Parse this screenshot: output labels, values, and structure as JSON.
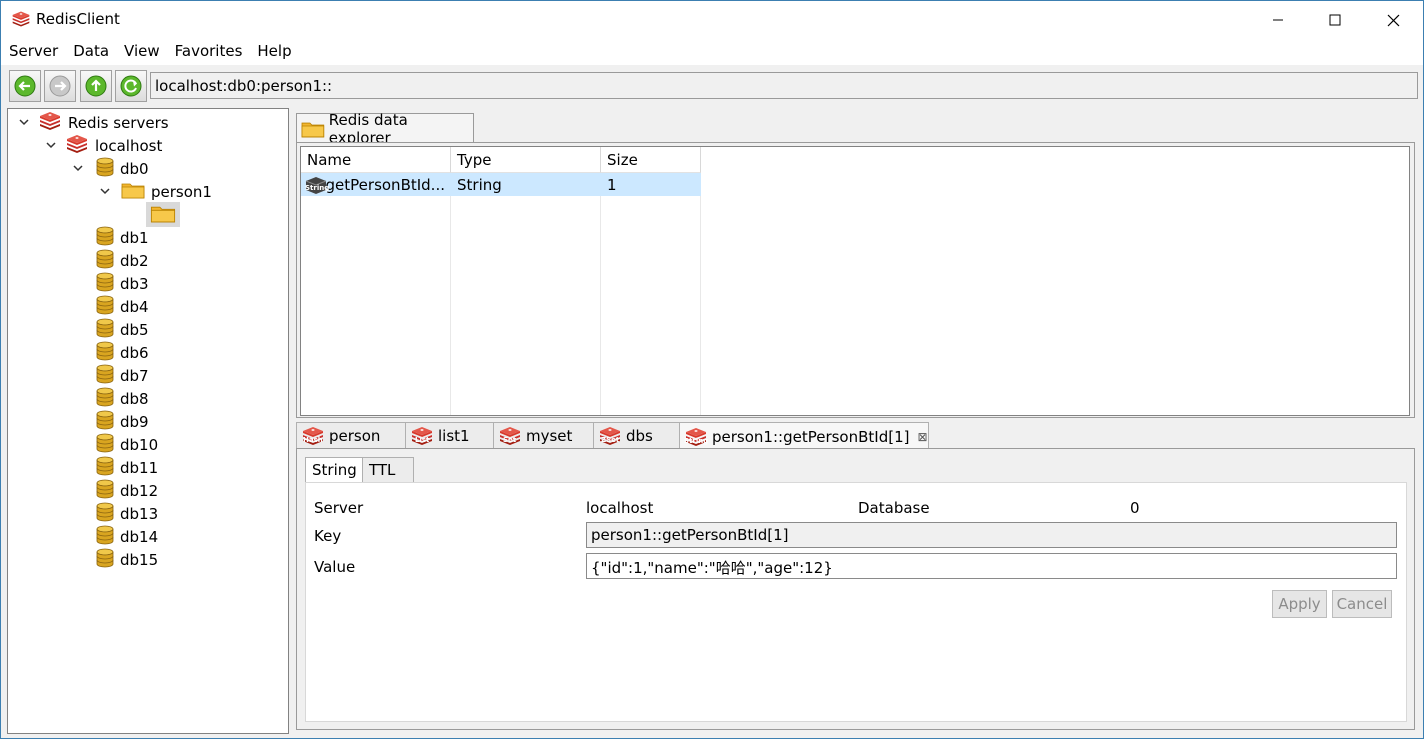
{
  "window": {
    "title": "RedisClient"
  },
  "menu": [
    "Server",
    "Data",
    "View",
    "Favorites",
    "Help"
  ],
  "toolbar": {
    "address": "localhost:db0:person1::"
  },
  "tree": {
    "root": "Redis servers",
    "server": "localhost",
    "db0": "db0",
    "folder": "person1",
    "dbs": [
      "db1",
      "db2",
      "db3",
      "db4",
      "db5",
      "db6",
      "db7",
      "db8",
      "db9",
      "db10",
      "db11",
      "db12",
      "db13",
      "db14",
      "db15"
    ]
  },
  "explorer": {
    "tab": "Redis data explorer",
    "columns": [
      "Name",
      "Type",
      "Size"
    ],
    "rows": [
      {
        "badge": "String",
        "name": "getPersonBtId...",
        "type": "String",
        "size": "1"
      }
    ]
  },
  "editor": {
    "tabs": [
      {
        "badge": "Hash",
        "label": "person"
      },
      {
        "badge": "List",
        "label": "list1"
      },
      {
        "badge": "Set",
        "label": "myset"
      },
      {
        "badge": "ZSet",
        "label": "dbs"
      },
      {
        "badge": "String",
        "label": "person1::getPersonBtId[1]",
        "close": "⊠"
      }
    ],
    "subtabs": [
      "String",
      "TTL"
    ],
    "server_label": "Server",
    "server_value": "localhost",
    "database_label": "Database",
    "database_value": "0",
    "key_label": "Key",
    "key_value": "person1::getPersonBtId[1]",
    "value_label": "Value",
    "value_value": "{\"id\":1,\"name\":\"哈哈\",\"age\":12}",
    "apply": "Apply",
    "cancel": "Cancel"
  },
  "colors": {
    "accent": "#3c7fb1",
    "selection": "#cce8ff",
    "redis_red": "#c9302c",
    "db_gold": "#d9a520",
    "folder": "#f2b530"
  }
}
